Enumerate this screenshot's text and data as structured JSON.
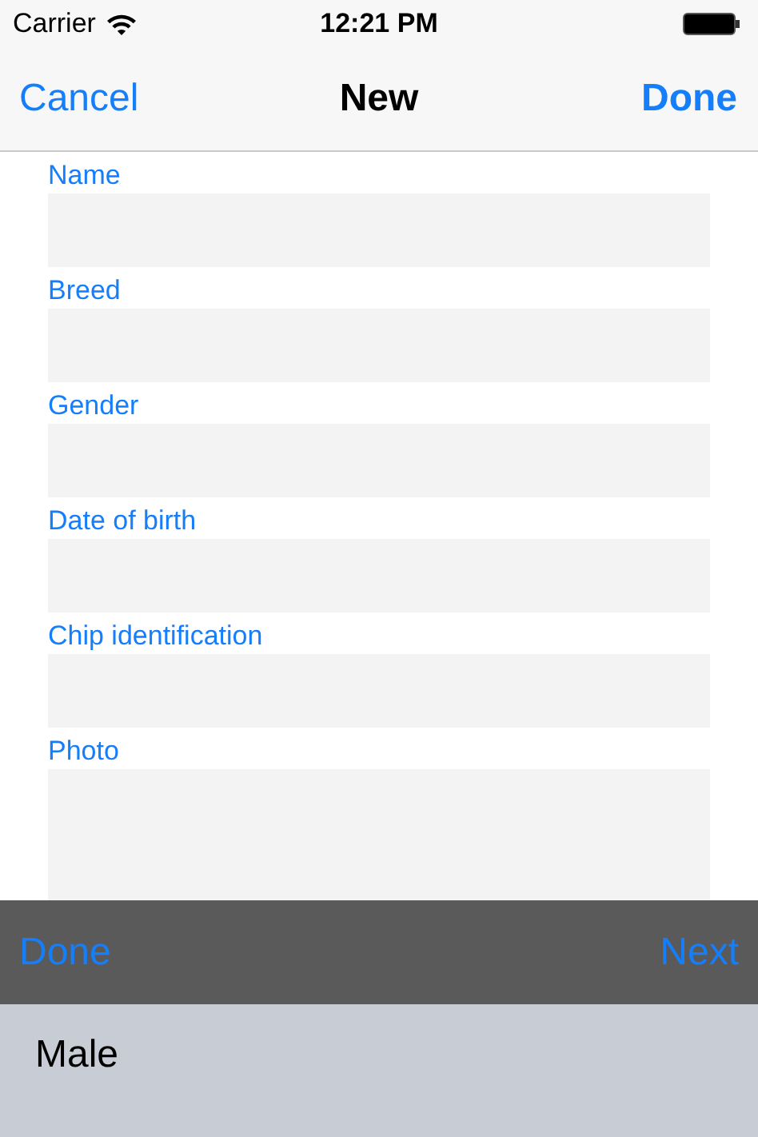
{
  "status_bar": {
    "carrier": "Carrier",
    "time": "12:21 PM"
  },
  "nav_bar": {
    "left": "Cancel",
    "title": "New",
    "right": "Done"
  },
  "fields": [
    {
      "label": "Name",
      "kind": "text"
    },
    {
      "label": "Breed",
      "kind": "text"
    },
    {
      "label": "Gender",
      "kind": "text"
    },
    {
      "label": "Date of birth",
      "kind": "text"
    },
    {
      "label": "Chip identification",
      "kind": "text"
    },
    {
      "label": "Photo",
      "kind": "photo"
    }
  ],
  "keyboard_toolbar": {
    "left": "Done",
    "right": "Next"
  },
  "picker": {
    "items": [
      {
        "label": "Male",
        "selected": true
      }
    ]
  }
}
